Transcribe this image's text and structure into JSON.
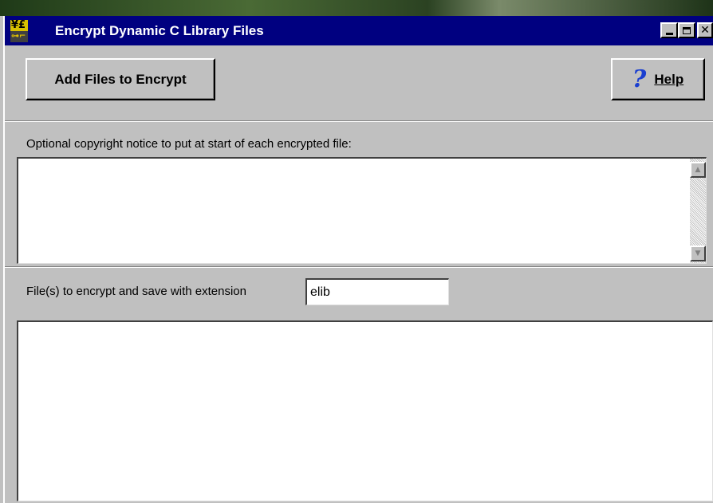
{
  "window": {
    "title": "Encrypt Dynamic C Library Files",
    "icon": "key-currency-icon",
    "controls": [
      "minimize-icon",
      "maximize-icon",
      "close-icon"
    ]
  },
  "toolbar": {
    "add_files_label": "Add Files to Encrypt",
    "help_label": "Help",
    "help_icon": "question-mark-icon"
  },
  "copyright": {
    "label": "Optional copyright notice to put at start of each encrypted file:",
    "value": ""
  },
  "files": {
    "label": "File(s) to encrypt and save with extension",
    "extension_value": "elib",
    "items": []
  },
  "colors": {
    "titlebar": "#000080",
    "face": "#c0c0c0",
    "help_icon": "#1a3fd0"
  }
}
